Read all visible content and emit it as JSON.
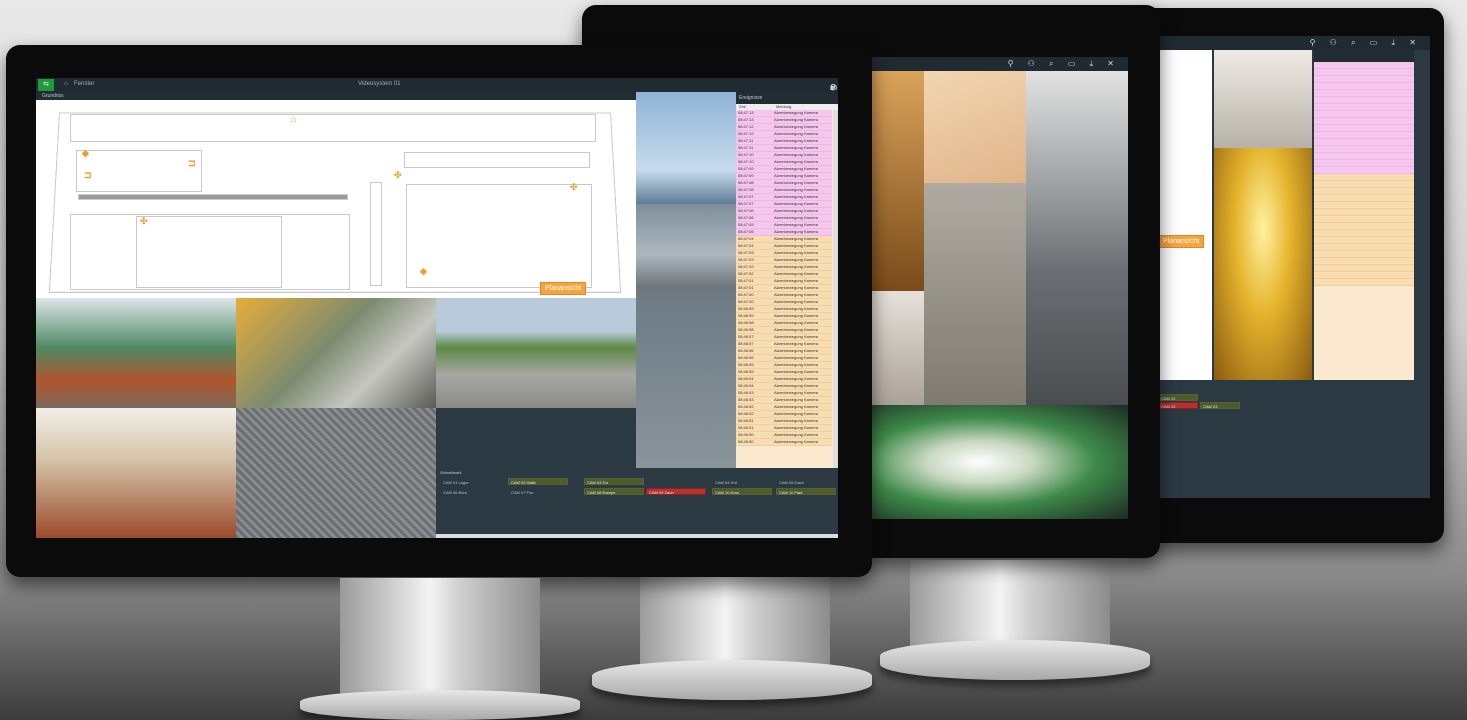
{
  "monitor1": {
    "header": {
      "tab_label": "Fenster",
      "window_title": "Videosystem 01"
    },
    "section_label": "Grundriss",
    "floor_plan_badge": "Planansicht",
    "log_tab": "Ereignisse",
    "log_columns": [
      "Zeit",
      "Meldung"
    ],
    "log_rows": [
      {
        "time": "08:47:13",
        "msg": "Alarmbewegung Kamera",
        "color": "pink"
      },
      {
        "time": "08:47:13",
        "msg": "Alarmbewegung Kamera",
        "color": "pink"
      },
      {
        "time": "08:47:12",
        "msg": "Alarmbewegung Kamera",
        "color": "pink"
      },
      {
        "time": "08:47:12",
        "msg": "Alarmbewegung Kamera",
        "color": "pink"
      },
      {
        "time": "08:47:11",
        "msg": "Alarmbewegung Kamera",
        "color": "pink"
      },
      {
        "time": "08:47:11",
        "msg": "Alarmbewegung Kamera",
        "color": "pink"
      },
      {
        "time": "08:47:10",
        "msg": "Alarmbewegung Kamera",
        "color": "pink"
      },
      {
        "time": "08:47:10",
        "msg": "Alarmbewegung Kamera",
        "color": "pink"
      },
      {
        "time": "08:47:09",
        "msg": "Alarmbewegung Kamera",
        "color": "pink"
      },
      {
        "time": "08:47:09",
        "msg": "Alarmbewegung Kamera",
        "color": "pink"
      },
      {
        "time": "08:47:08",
        "msg": "Alarmbewegung Kamera",
        "color": "pink"
      },
      {
        "time": "08:47:08",
        "msg": "Alarmbewegung Kamera",
        "color": "pink"
      },
      {
        "time": "08:47:07",
        "msg": "Alarmbewegung Kamera",
        "color": "pink"
      },
      {
        "time": "08:47:07",
        "msg": "Alarmbewegung Kamera",
        "color": "pink"
      },
      {
        "time": "08:47:06",
        "msg": "Alarmbewegung Kamera",
        "color": "pink"
      },
      {
        "time": "08:47:06",
        "msg": "Alarmbewegung Kamera",
        "color": "pink"
      },
      {
        "time": "08:47:05",
        "msg": "Alarmbewegung Kamera",
        "color": "pink"
      },
      {
        "time": "08:47:05",
        "msg": "Alarmbewegung Kamera",
        "color": "pink"
      },
      {
        "time": "08:47:04",
        "msg": "Alarmbewegung Kamera",
        "color": "peach"
      },
      {
        "time": "08:47:04",
        "msg": "Alarmbewegung Kamera",
        "color": "peach"
      },
      {
        "time": "08:47:03",
        "msg": "Alarmbewegung Kamera",
        "color": "peach"
      },
      {
        "time": "08:47:03",
        "msg": "Alarmbewegung Kamera",
        "color": "peach"
      },
      {
        "time": "08:47:02",
        "msg": "Alarmbewegung Kamera",
        "color": "peach"
      },
      {
        "time": "08:47:02",
        "msg": "Alarmbewegung Kamera",
        "color": "peach"
      },
      {
        "time": "08:47:01",
        "msg": "Alarmbewegung Kamera",
        "color": "peach"
      },
      {
        "time": "08:47:01",
        "msg": "Alarmbewegung Kamera",
        "color": "peach"
      },
      {
        "time": "08:47:00",
        "msg": "Alarmbewegung Kamera",
        "color": "peach"
      },
      {
        "time": "08:47:00",
        "msg": "Alarmbewegung Kamera",
        "color": "peach"
      },
      {
        "time": "08:46:59",
        "msg": "Alarmbewegung Kamera",
        "color": "peach"
      },
      {
        "time": "08:46:59",
        "msg": "Alarmbewegung Kamera",
        "color": "peach"
      },
      {
        "time": "08:46:58",
        "msg": "Alarmbewegung Kamera",
        "color": "peach"
      },
      {
        "time": "08:46:58",
        "msg": "Alarmbewegung Kamera",
        "color": "peach"
      },
      {
        "time": "08:46:57",
        "msg": "Alarmbewegung Kamera",
        "color": "peach"
      },
      {
        "time": "08:46:57",
        "msg": "Alarmbewegung Kamera",
        "color": "peach"
      },
      {
        "time": "08:46:56",
        "msg": "Alarmbewegung Kamera",
        "color": "peach"
      },
      {
        "time": "08:46:56",
        "msg": "Alarmbewegung Kamera",
        "color": "peach"
      },
      {
        "time": "08:46:55",
        "msg": "Alarmbewegung Kamera",
        "color": "peach"
      },
      {
        "time": "08:46:55",
        "msg": "Alarmbewegung Kamera",
        "color": "peach"
      },
      {
        "time": "08:46:54",
        "msg": "Alarmbewegung Kamera",
        "color": "peach"
      },
      {
        "time": "08:46:54",
        "msg": "Alarmbewegung Kamera",
        "color": "peach"
      },
      {
        "time": "08:46:53",
        "msg": "Alarmbewegung Kamera",
        "color": "peach"
      },
      {
        "time": "08:46:53",
        "msg": "Alarmbewegung Kamera",
        "color": "peach"
      },
      {
        "time": "08:46:52",
        "msg": "Alarmbewegung Kamera",
        "color": "peach"
      },
      {
        "time": "08:46:52",
        "msg": "Alarmbewegung Kamera",
        "color": "peach"
      },
      {
        "time": "08:46:51",
        "msg": "Alarmbewegung Kamera",
        "color": "peach"
      },
      {
        "time": "08:46:51",
        "msg": "Alarmbewegung Kamera",
        "color": "peach"
      },
      {
        "time": "08:46:50",
        "msg": "Alarmbewegung Kamera",
        "color": "peach"
      },
      {
        "time": "08:46:50",
        "msg": "Alarmbewegung Kamera",
        "color": "peach"
      }
    ],
    "alarm_panel": {
      "title": "Schnellwahl",
      "cells": [
        {
          "label": "CAM 01 Lager",
          "state": "plain"
        },
        {
          "label": "CAM 02 Halle",
          "state": "green"
        },
        {
          "label": "CAM 03 Tor",
          "state": "green"
        },
        {
          "label": "CAM 04 Hof",
          "state": "plain"
        },
        {
          "label": "CAM 05 Dach",
          "state": "plain"
        },
        {
          "label": "CAM 06 Büro",
          "state": "plain"
        },
        {
          "label": "CAM 07 Flur",
          "state": "plain"
        },
        {
          "label": "CAM 08 Rampe",
          "state": "green"
        },
        {
          "label": "CAM 09 Zaun",
          "state": "red"
        },
        {
          "label": "CAM 10 Kran",
          "state": "green"
        },
        {
          "label": "CAM 11 Park",
          "state": "green"
        }
      ]
    }
  },
  "monitor2": {
    "log_rows_count_label": ""
  },
  "monitor3": {
    "badge": "Planansicht",
    "alarm_cells": [
      {
        "label": "CAM 21",
        "state": "green"
      },
      {
        "label": "CAM 22",
        "state": "red"
      },
      {
        "label": "CAM 23",
        "state": "green"
      }
    ]
  },
  "icons": [
    "user-icon",
    "users-icon",
    "search-icon",
    "monitor-icon",
    "download-icon",
    "close-icon"
  ]
}
